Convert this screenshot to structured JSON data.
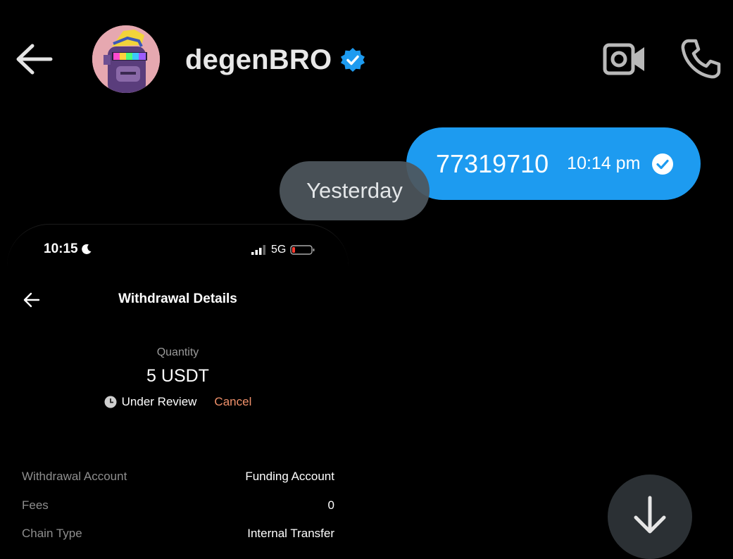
{
  "header": {
    "back_icon": "arrow-left-icon",
    "username": "degenBRO",
    "verified_icon": "verified-badge-icon",
    "video_icon": "video-camera-icon",
    "phone_icon": "phone-icon",
    "accent": "#1d9bf0"
  },
  "message": {
    "text": "77319710",
    "time": "10:14 pm",
    "status_icon": "read-check-icon",
    "bubble_color": "#1d9bf0"
  },
  "date_separator": "Yesterday",
  "screenshot": {
    "status_bar": {
      "time": "10:15",
      "network": "5G"
    },
    "title": "Withdrawal Details",
    "quantity_label": "Quantity",
    "quantity_value": "5 USDT",
    "status": "Under Review",
    "cancel_label": "Cancel",
    "details": [
      {
        "key": "Withdrawal Account",
        "value": "Funding Account"
      },
      {
        "key": "Fees",
        "value": "0"
      },
      {
        "key": "Chain Type",
        "value": "Internal Transfer"
      }
    ]
  },
  "scroll_down_icon": "arrow-down-icon"
}
